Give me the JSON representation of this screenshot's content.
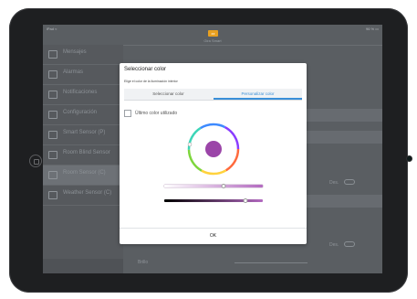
{
  "status_bar": {
    "carrier": "iPad ≈",
    "battery": "96 % ▭"
  },
  "app": {
    "logo_text": "zz",
    "title": "Gira Smart"
  },
  "sidebar": {
    "items": [
      {
        "label": "Mensajes",
        "sub": ""
      },
      {
        "label": "Alarmas",
        "sub": ""
      },
      {
        "label": "Notificaciones",
        "sub": ""
      },
      {
        "label": "Configuración",
        "sub": ""
      },
      {
        "label": "Smart Sensor (P)",
        "sub": ""
      },
      {
        "label": "Room Blind Sensor",
        "sub": ""
      },
      {
        "label": "Room Sensor (C)",
        "sub": ""
      },
      {
        "label": "Weather Sensor (C)",
        "sub": ""
      }
    ],
    "selected_index": 6
  },
  "background_controls": {
    "toggle_label_1": "Des.",
    "toggle_label_2": "Des.",
    "footer_label": "Brillo"
  },
  "dialog": {
    "title": "Seleccionar color",
    "subtitle": "Elige el color de la iluminación interior",
    "tabs": [
      {
        "label": "Seleccionar color",
        "active": false
      },
      {
        "label": "Personalizar color",
        "active": true
      }
    ],
    "last_color_checkbox": {
      "label": "Último color utilizado",
      "checked": false
    },
    "selected_color": "#9b45a8",
    "saturation_level": 0.6,
    "brightness_level": 0.82,
    "ok_label": "OK"
  },
  "colors": {
    "accent": "#3a8fd8",
    "selected": "#9b45a8"
  }
}
